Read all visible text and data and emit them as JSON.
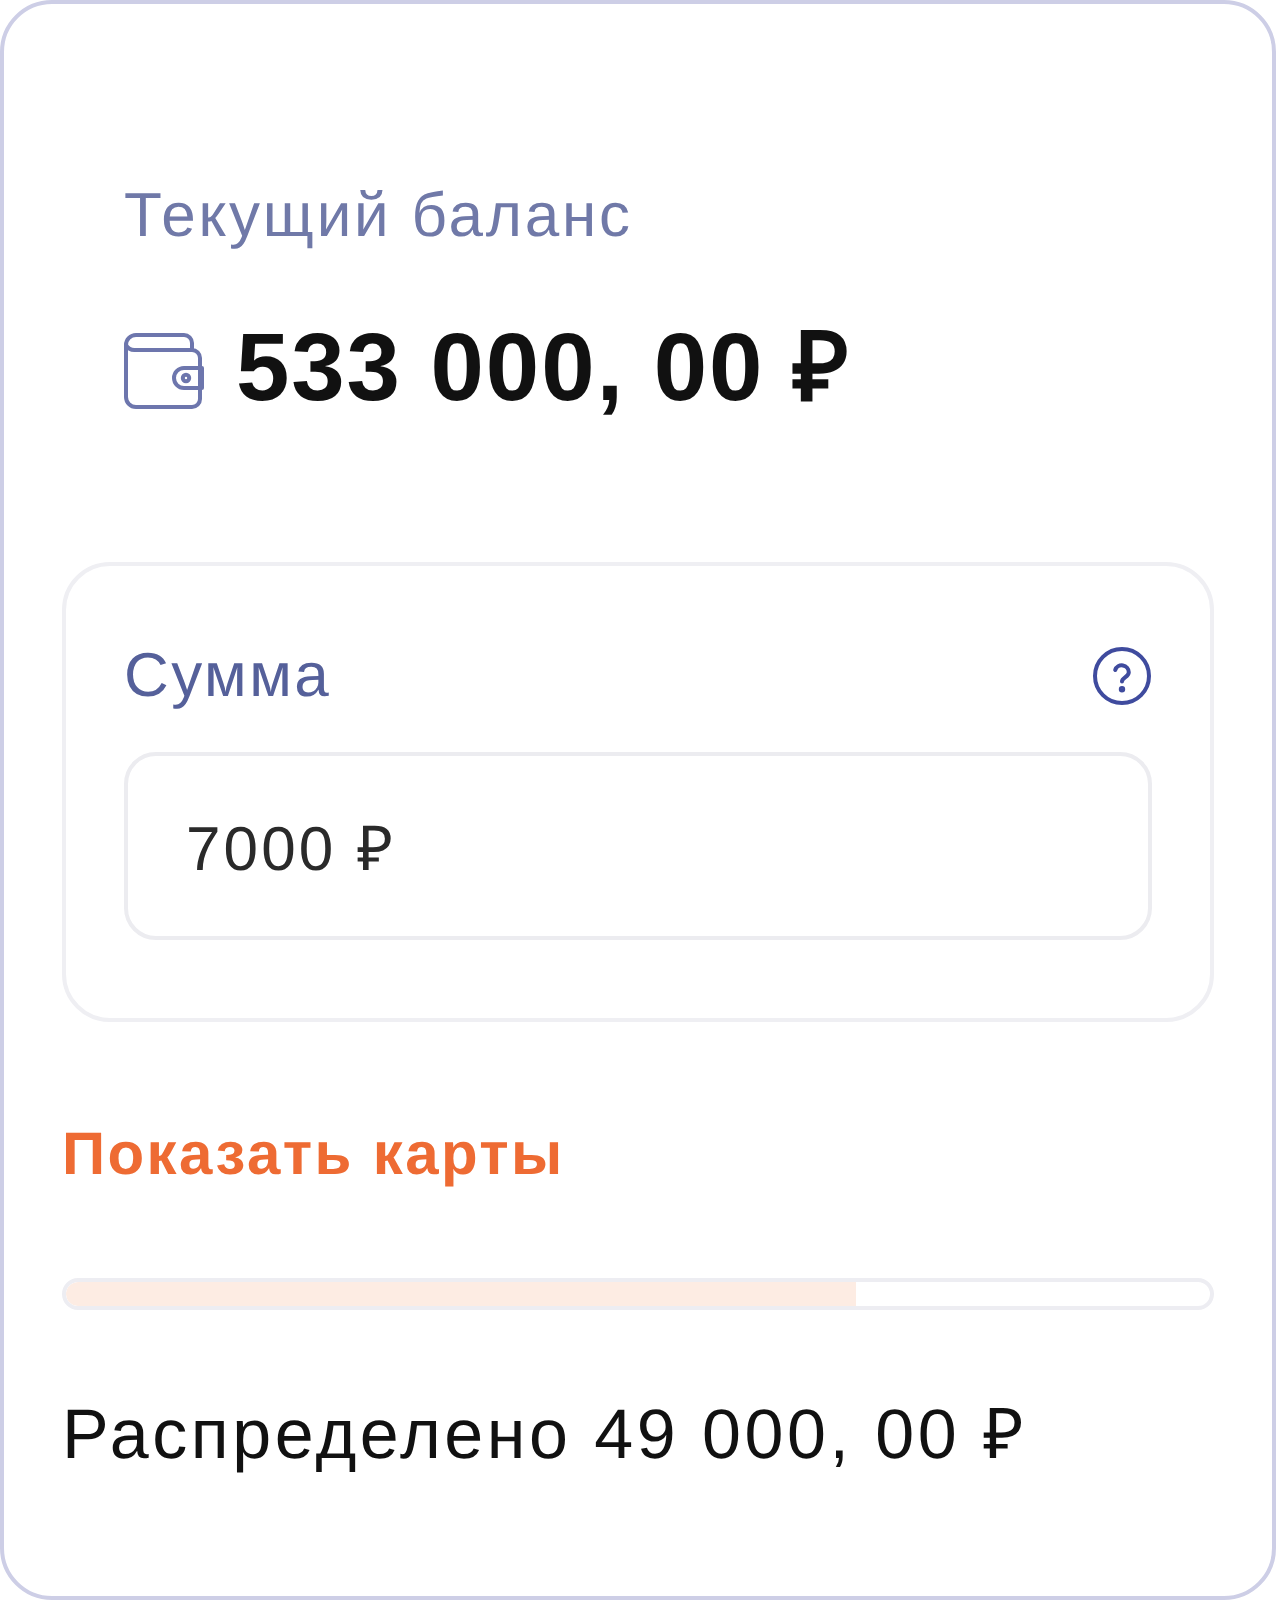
{
  "balance": {
    "label": "Текущий баланс",
    "amount": "533 000, 00 ₽"
  },
  "amount_field": {
    "label": "Сумма",
    "value": "7000 ₽"
  },
  "show_cards_link": "Показать карты",
  "distribution": {
    "level": 0.69,
    "summary": "Распределено 49 000, 00 ₽"
  }
}
